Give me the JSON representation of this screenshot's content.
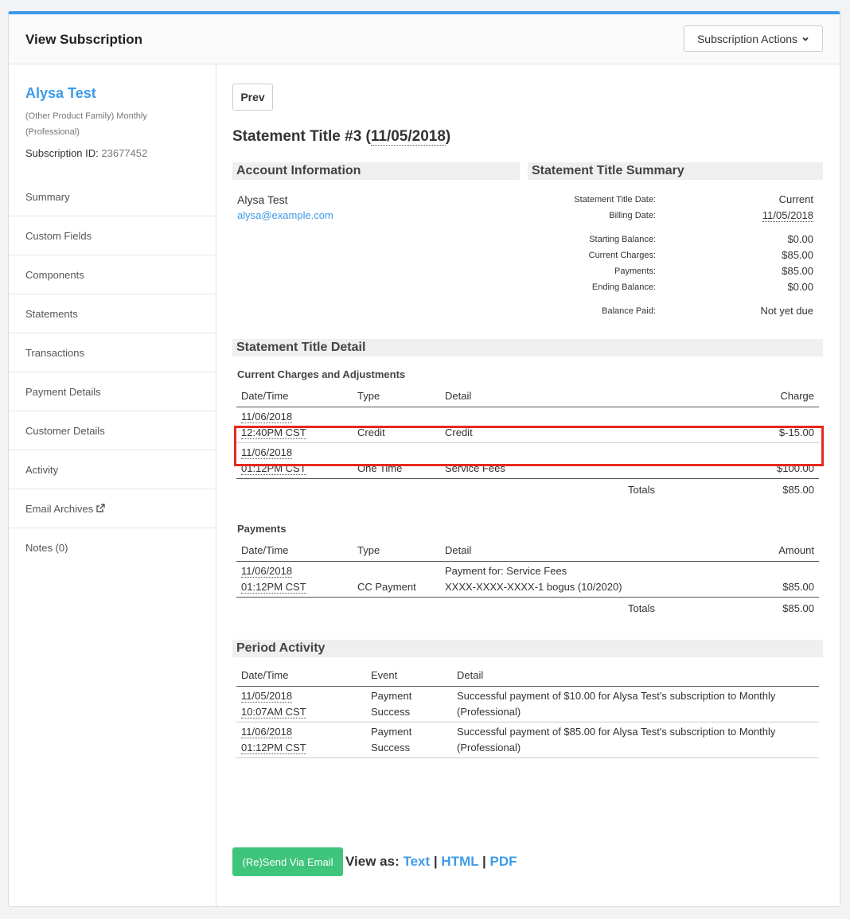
{
  "header": {
    "title": "View Subscription",
    "actions_label": "Subscription Actions"
  },
  "customer": {
    "name": "Alysa Test",
    "plan": "(Other Product Family) Monthly (Professional)",
    "sub_id_label": "Subscription ID:",
    "sub_id": "23677452"
  },
  "nav": [
    {
      "label": "Summary"
    },
    {
      "label": "Custom Fields"
    },
    {
      "label": "Components"
    },
    {
      "label": "Statements"
    },
    {
      "label": "Transactions"
    },
    {
      "label": "Payment Details"
    },
    {
      "label": "Customer Details"
    },
    {
      "label": "Activity"
    },
    {
      "label": "Email Archives"
    },
    {
      "label": "Notes (0)"
    }
  ],
  "main": {
    "prev_label": "Prev",
    "title_prefix": "Statement Title #3 (",
    "title_date": "11/05/2018",
    "title_suffix": ")",
    "account_heading": "Account Information",
    "account_name": "Alysa Test",
    "account_email": "alysa@example.com",
    "summary_heading": "Statement Title Summary",
    "summary": [
      {
        "k": "Statement Title Date:",
        "v": "Current"
      },
      {
        "k": "Billing Date:",
        "v": "11/05/2018"
      },
      {
        "k": "Starting Balance:",
        "v": "$0.00"
      },
      {
        "k": "Current Charges:",
        "v": "$85.00"
      },
      {
        "k": "Payments:",
        "v": "$85.00"
      },
      {
        "k": "Ending Balance:",
        "v": "$0.00"
      },
      {
        "k": "Balance Paid:",
        "v": "Not yet due"
      }
    ],
    "detail_heading": "Statement Title Detail",
    "charges": {
      "heading": "Current Charges and Adjustments",
      "cols": [
        "Date/Time",
        "Type",
        "Detail",
        "Charge"
      ],
      "rows": [
        {
          "date": "11/06/2018",
          "time": "12:40PM CST",
          "type": "Credit",
          "detail": "Credit",
          "amount": "$-15.00"
        },
        {
          "date": "11/06/2018",
          "time": "01:12PM CST",
          "type": "One Time",
          "detail": "Service Fees",
          "amount": "$100.00"
        }
      ],
      "totals_label": "Totals",
      "totals": "$85.00"
    },
    "payments": {
      "heading": "Payments",
      "cols": [
        "Date/Time",
        "Type",
        "Detail",
        "Amount"
      ],
      "rows": [
        {
          "date": "11/06/2018",
          "time": "01:12PM CST",
          "type": "CC Payment",
          "detail1": "Payment for: Service Fees",
          "detail2": "XXXX-XXXX-XXXX-1 bogus (10/2020)",
          "amount": "$85.00"
        }
      ],
      "totals_label": "Totals",
      "totals": "$85.00"
    },
    "activity": {
      "heading": "Period Activity",
      "cols": [
        "Date/Time",
        "Event",
        "Detail"
      ],
      "rows": [
        {
          "date": "11/05/2018",
          "time": "10:07AM CST",
          "event1": "Payment",
          "event2": "Success",
          "detail": "Successful payment of $10.00 for Alysa Test's subscription to Monthly (Professional)"
        },
        {
          "date": "11/06/2018",
          "time": "01:12PM CST",
          "event1": "Payment",
          "event2": "Success",
          "detail": "Successful payment of $85.00 for Alysa Test's subscription to Monthly (Professional)"
        }
      ]
    },
    "resend_label": "(Re)Send Via Email",
    "view_as_label": "View as:",
    "view_text": "Text",
    "view_html": "HTML",
    "view_pdf": "PDF",
    "sep": "|"
  }
}
